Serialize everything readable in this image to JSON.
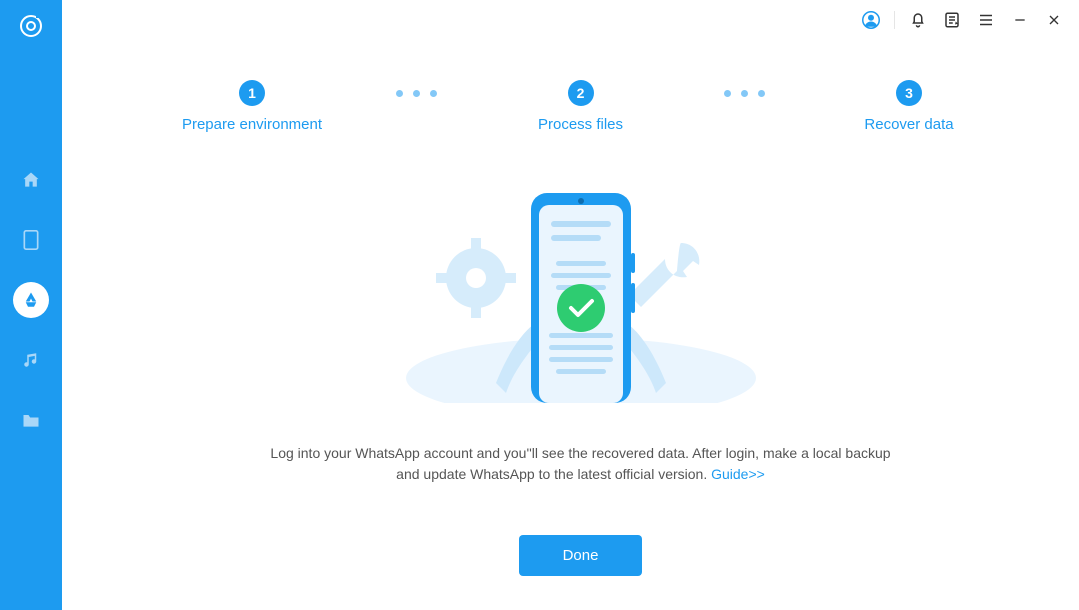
{
  "sidebar": {
    "items": [
      {
        "name": "home"
      },
      {
        "name": "device"
      },
      {
        "name": "recovery",
        "active": true
      },
      {
        "name": "music"
      },
      {
        "name": "folder"
      }
    ]
  },
  "titlebar": {
    "icons": [
      "account",
      "bell",
      "notes",
      "menu",
      "minimize",
      "close"
    ]
  },
  "steps": [
    {
      "num": "1",
      "label": "Prepare environment"
    },
    {
      "num": "2",
      "label": "Process files"
    },
    {
      "num": "3",
      "label": "Recover data"
    }
  ],
  "instruction": {
    "text_before": "Log into your WhatsApp account and you''ll see the recovered data. After login, make a local backup and update WhatsApp to the latest official version. ",
    "link": "Guide>>"
  },
  "buttons": {
    "done": "Done"
  }
}
